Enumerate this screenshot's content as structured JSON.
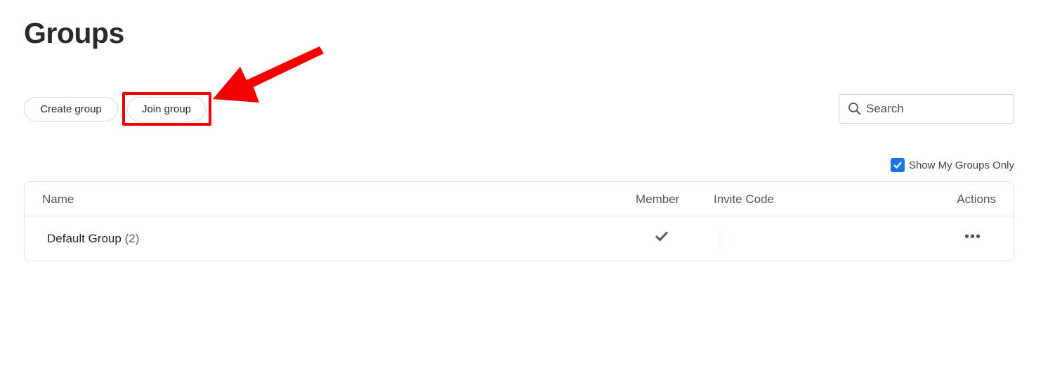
{
  "page": {
    "title": "Groups"
  },
  "toolbar": {
    "create_label": "Create group",
    "join_label": "Join group"
  },
  "search": {
    "placeholder": "Search",
    "value": ""
  },
  "filter": {
    "label": "Show My Groups Only",
    "checked": true
  },
  "table": {
    "columns": {
      "name": "Name",
      "member": "Member",
      "invite_code": "Invite Code",
      "actions": "Actions"
    },
    "rows": [
      {
        "name": "Default Group",
        "count": "(2)",
        "member": true,
        "invite_code": "",
        "actions": "•••"
      }
    ]
  },
  "colors": {
    "highlight": "#f20000",
    "checkbox": "#1a73e8"
  },
  "annotation": {
    "highlight_target": "join-group-button",
    "icon": "red-arrow-icon"
  }
}
